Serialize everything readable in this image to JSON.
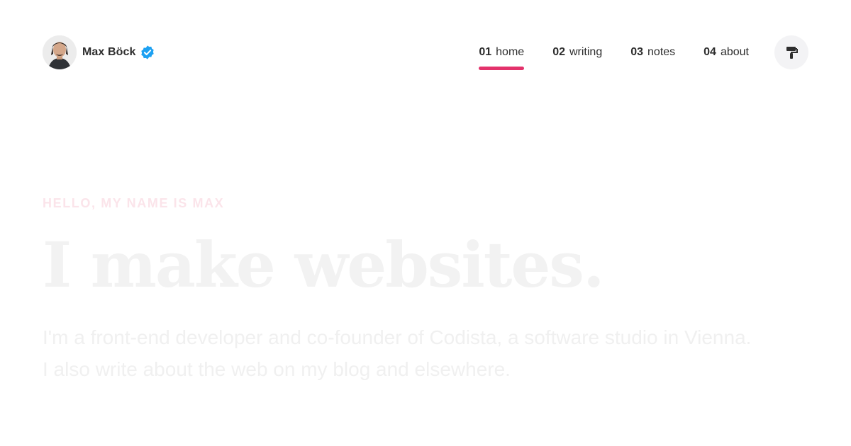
{
  "brand": {
    "name": "Max Böck",
    "avatar_alt": "Max Böck",
    "verified_icon": "verified-badge-icon",
    "verified_color": "#1da1f2"
  },
  "nav": {
    "items": [
      {
        "num": "01",
        "label": "home",
        "active": true
      },
      {
        "num": "02",
        "label": "writing",
        "active": false
      },
      {
        "num": "03",
        "label": "notes",
        "active": false
      },
      {
        "num": "04",
        "label": "about",
        "active": false
      }
    ],
    "active_color": "#e3326b"
  },
  "theme_button": {
    "icon": "paint-roller-icon"
  },
  "hero": {
    "kicker": "HELLO, MY NAME IS MAX",
    "headline": "I make websites.",
    "intro": "I'm a front-end developer and co-founder of Codista, a software studio in Vienna. I also write about the web on my blog and elsewhere."
  }
}
